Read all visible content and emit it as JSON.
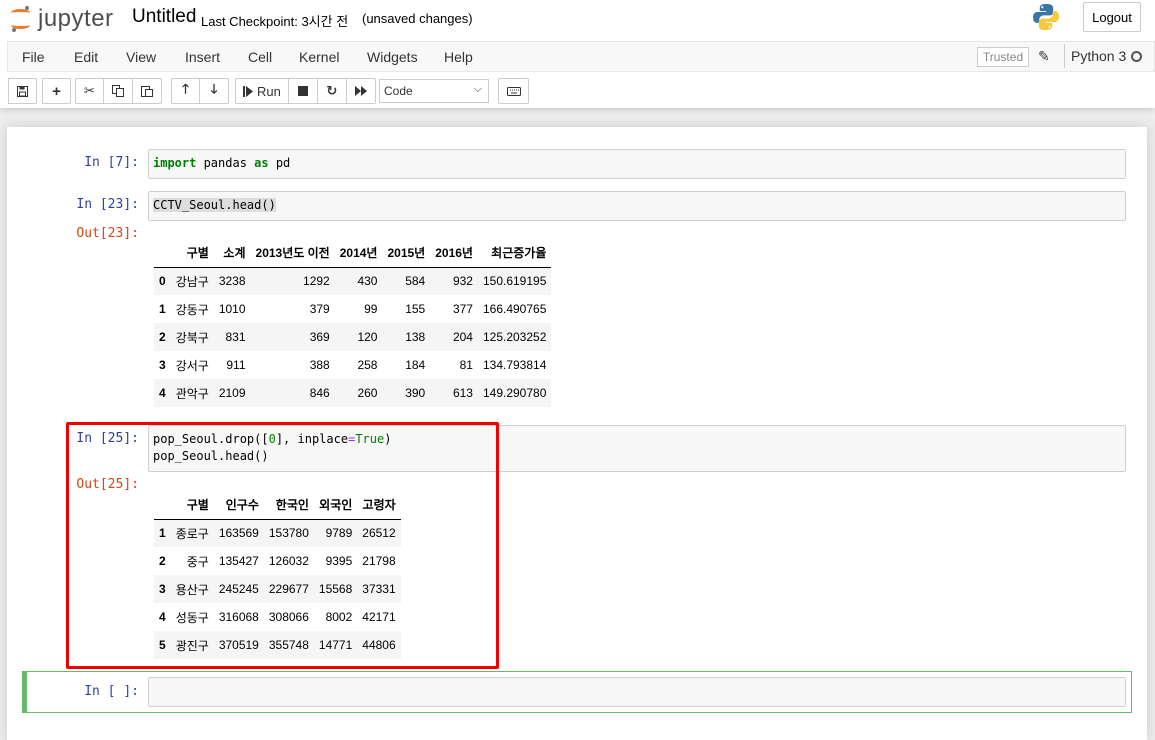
{
  "header": {
    "logo_text": "jupyter",
    "notebook_title": "Untitled",
    "checkpoint": "Last Checkpoint: 3시간 전",
    "autosave_status": "(unsaved changes)",
    "logout_label": "Logout"
  },
  "menu": {
    "items": [
      "File",
      "Edit",
      "View",
      "Insert",
      "Cell",
      "Kernel",
      "Widgets",
      "Help"
    ],
    "trusted_label": "Trusted",
    "kernel_name": "Python 3"
  },
  "toolbar": {
    "run_label": "Run",
    "cell_type_value": "Code",
    "icons": [
      "save-icon",
      "plus-icon",
      "cut-icon",
      "copy-icon",
      "paste-icon",
      "arrow-up-icon",
      "arrow-down-icon",
      "step-forward-icon",
      "stop-icon",
      "restart-icon",
      "fast-forward-icon",
      "keyboard-icon"
    ]
  },
  "cells": {
    "c1": {
      "prompt": "In [7]:",
      "tok1": "import",
      "tok2": " pandas ",
      "tok3": "as",
      "tok4": " pd"
    },
    "c2": {
      "prompt": "In [23]:",
      "code": "CCTV_Seoul.head()",
      "out_prompt": "Out[23]:"
    },
    "c3": {
      "prompt": "In [25]:",
      "line1a": "pop_Seoul.drop([",
      "line1b": "0",
      "line1c": "], inplace",
      "line1d": "=",
      "line1e": "True",
      "line1f": ")",
      "line2": "pop_Seoul.head()",
      "out_prompt": "Out[25]:"
    },
    "c4": {
      "prompt": "In [ ]:"
    }
  },
  "cctv_table": {
    "columns": [
      "",
      "구별",
      "소계",
      "2013년도 이전",
      "2014년",
      "2015년",
      "2016년",
      "최근증가율"
    ],
    "rows": [
      [
        "0",
        "강남구",
        "3238",
        "1292",
        "430",
        "584",
        "932",
        "150.619195"
      ],
      [
        "1",
        "강동구",
        "1010",
        "379",
        "99",
        "155",
        "377",
        "166.490765"
      ],
      [
        "2",
        "강북구",
        "831",
        "369",
        "120",
        "138",
        "204",
        "125.203252"
      ],
      [
        "3",
        "강서구",
        "911",
        "388",
        "258",
        "184",
        "81",
        "134.793814"
      ],
      [
        "4",
        "관악구",
        "2109",
        "846",
        "260",
        "390",
        "613",
        "149.290780"
      ]
    ]
  },
  "pop_table": {
    "columns": [
      "",
      "구별",
      "인구수",
      "한국인",
      "외국인",
      "고령자"
    ],
    "rows": [
      [
        "1",
        "종로구",
        "163569",
        "153780",
        "9789",
        "26512"
      ],
      [
        "2",
        "중구",
        "135427",
        "126032",
        "9395",
        "21798"
      ],
      [
        "3",
        "용산구",
        "245245",
        "229677",
        "15568",
        "37331"
      ],
      [
        "4",
        "성동구",
        "316068",
        "308066",
        "8002",
        "42171"
      ],
      [
        "5",
        "광진구",
        "370519",
        "355748",
        "14771",
        "44806"
      ]
    ]
  },
  "colors": {
    "in_prompt": "#303f9f",
    "out_prompt": "#d84315",
    "highlight_border": "#ee0000",
    "selected_cell": "#66bb6a"
  }
}
